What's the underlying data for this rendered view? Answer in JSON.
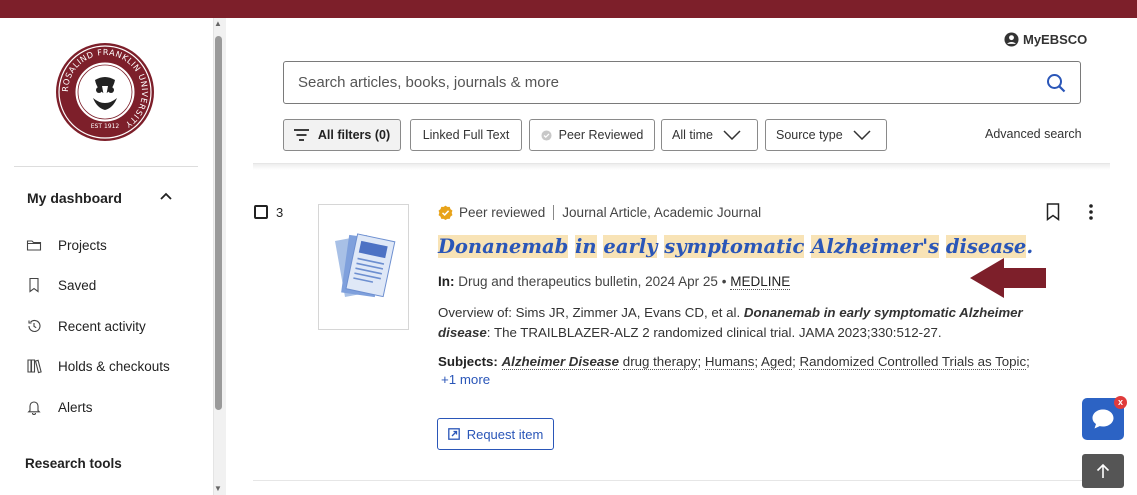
{
  "colors": {
    "brand": "#7d1f2a",
    "link": "#2a56b8",
    "highlight": "#f8e3b6",
    "peer_badge": "#e8a31a",
    "chat": "#2c63c4"
  },
  "header": {
    "account_label": "MyEBSCO"
  },
  "logo": {
    "university_name": "ROSALIND FRANKLIN UNIVERSITY",
    "established": "EST 1912"
  },
  "sidebar": {
    "dashboard_heading": "My dashboard",
    "items": [
      {
        "label": "Projects",
        "icon": "folder-icon"
      },
      {
        "label": "Saved",
        "icon": "bookmark-icon"
      },
      {
        "label": "Recent activity",
        "icon": "history-icon"
      },
      {
        "label": "Holds & checkouts",
        "icon": "books-icon"
      },
      {
        "label": "Alerts",
        "icon": "bell-icon"
      }
    ],
    "research_tools": "Research tools"
  },
  "search": {
    "placeholder": "Search articles, books, journals & more"
  },
  "filters": {
    "all_filters": "All filters (0)",
    "linked_full_text": "Linked Full Text",
    "peer_reviewed": "Peer Reviewed",
    "all_time": "All time",
    "source_type": "Source type",
    "advanced_search": "Advanced search"
  },
  "result": {
    "number": "3",
    "peer_label": "Peer reviewed",
    "type": "Journal Article, Academic Journal",
    "title_words": [
      "Donanemab",
      "in",
      "early",
      "symptomatic",
      "Alzheimer's",
      "disease"
    ],
    "title_end": ".",
    "in_label": "In:",
    "source": "Drug and therapeutics bulletin, 2024 Apr 25",
    "bullet": "•",
    "database": "MEDLINE",
    "overview_prefix": "Overview of: Sims JR, Zimmer JA, Evans CD, et al.",
    "overview_bold": "Donanemab in early symptomatic Alzheimer disease",
    "overview_suffix": ": The TRAILBLAZER-ALZ 2 randomized clinical trial. JAMA 2023;330:512-27.",
    "subjects_label": "Subjects:",
    "subject_main": "Alzheimer Disease",
    "subject_main_suffix": "drug therapy",
    "subjects_rest": [
      "Humans",
      "Aged",
      "Randomized Controlled Trials as Topic"
    ],
    "more": "+1 more",
    "request_item": "Request item"
  },
  "chat": {
    "badge": "x"
  }
}
